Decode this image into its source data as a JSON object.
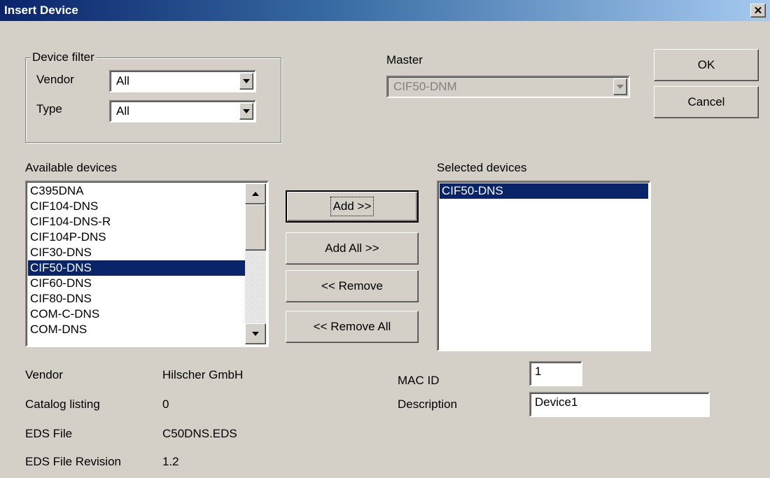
{
  "window": {
    "title": "Insert Device",
    "close_glyph": "✕"
  },
  "filter": {
    "legend": "Device filter",
    "vendor_label": "Vendor",
    "vendor_value": "All",
    "type_label": "Type",
    "type_value": "All"
  },
  "master": {
    "label": "Master",
    "value": "CIF50-DNM"
  },
  "buttons": {
    "ok": "OK",
    "cancel": "Cancel",
    "add": "Add >>",
    "add_all": "Add All >>",
    "remove": "<< Remove",
    "remove_all": "<< Remove All"
  },
  "available": {
    "label": "Available devices",
    "items": [
      "C395DNA",
      "CIF104-DNS",
      "CIF104-DNS-R",
      "CIF104P-DNS",
      "CIF30-DNS",
      "CIF50-DNS",
      "CIF60-DNS",
      "CIF80-DNS",
      "COM-C-DNS",
      "COM-DNS"
    ],
    "selected": "CIF50-DNS"
  },
  "selected_devices": {
    "label": "Selected devices",
    "items": [
      "CIF50-DNS"
    ]
  },
  "info": {
    "vendor_label": "Vendor",
    "vendor_value": "Hilscher GmbH",
    "catalog_label": "Catalog listing",
    "catalog_value": "0",
    "eds_label": "EDS File",
    "eds_value": "C50DNS.EDS",
    "eds_rev_label": "EDS File Revision",
    "eds_rev_value": "1.2"
  },
  "device": {
    "mac_label": "MAC ID",
    "mac_value": "1",
    "desc_label": "Description",
    "desc_value": "Device1"
  },
  "colors": {
    "selection": "#0a246a",
    "face": "#d4d0c8",
    "title_start": "#0a246a",
    "title_end": "#a6caf0"
  }
}
